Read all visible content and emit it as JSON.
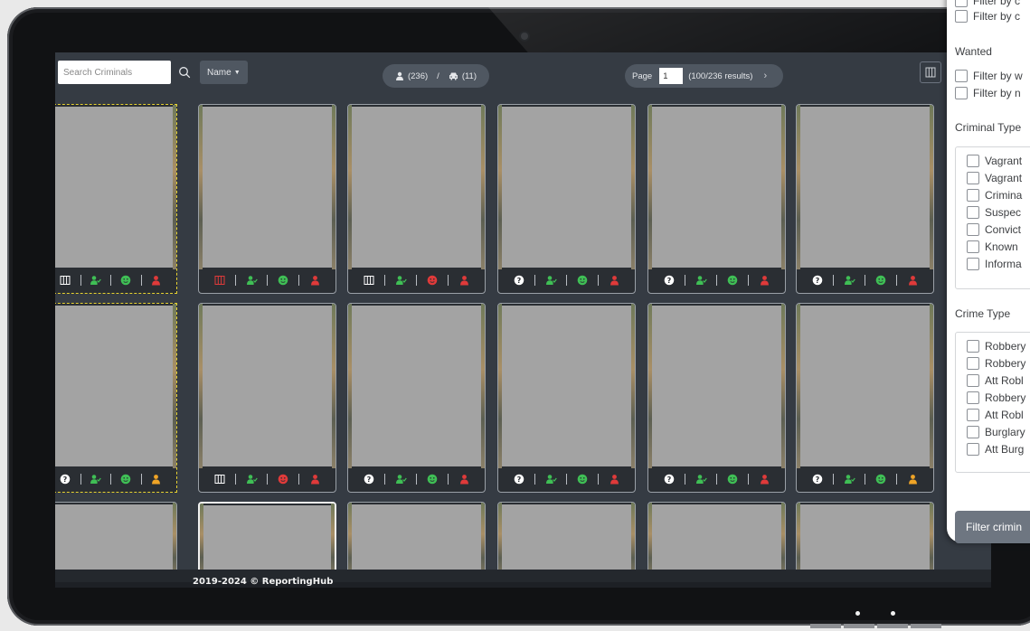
{
  "search": {
    "placeholder": "Search Criminals"
  },
  "sort": {
    "label": "Name"
  },
  "counts": {
    "people": "(236)",
    "separator": "/",
    "vehicles": "(11)"
  },
  "pagination": {
    "page_label": "Page",
    "page_value": "1",
    "results": "(100/236 results)"
  },
  "filter_panel": {
    "top_filters": [
      "Filter by c",
      "Filter by c"
    ],
    "wanted_title": "Wanted",
    "wanted_filters": [
      "Filter by w",
      "Filter by n"
    ],
    "criminal_type_title": "Criminal Type",
    "criminal_types": [
      "Vagrant",
      "Vagrant",
      "Crimina",
      "Suspec",
      "Convict",
      "Known",
      "Informa"
    ],
    "crime_type_title": "Crime Type",
    "crime_types": [
      "Robbery",
      "Robbery",
      "Att Robl",
      "Robbery",
      "Att Robl",
      "Burglary",
      "Att Burg"
    ],
    "filter_button": "Filter crimin"
  },
  "footer": {
    "text": "2019-2024 © ReportingHub"
  },
  "colors": {
    "green": "#3fbf55",
    "red": "#e03a3a",
    "orange": "#f0a426",
    "white": "#ffffff",
    "selected_border": "#e7d231"
  },
  "cards": [
    {
      "first": "columns-icon",
      "status": "green",
      "person": "red"
    },
    {
      "first": "columns-red-icon",
      "status": "green",
      "person": "red"
    },
    {
      "first": "columns-icon",
      "status": "red",
      "person": "red"
    },
    {
      "first": "question-icon",
      "status": "green",
      "person": "red"
    },
    {
      "first": "question-icon",
      "status": "green",
      "person": "red"
    },
    {
      "first": "question-icon",
      "status": "green",
      "person": "red"
    },
    {
      "first": "question-icon",
      "status": "green",
      "person": "orange"
    },
    {
      "first": "columns-icon",
      "status": "red",
      "person": "red"
    },
    {
      "first": "question-icon",
      "status": "green",
      "person": "red"
    },
    {
      "first": "question-icon",
      "status": "green",
      "person": "red"
    },
    {
      "first": "question-icon",
      "status": "green",
      "person": "red"
    },
    {
      "first": "question-icon",
      "status": "green",
      "person": "orange"
    }
  ]
}
